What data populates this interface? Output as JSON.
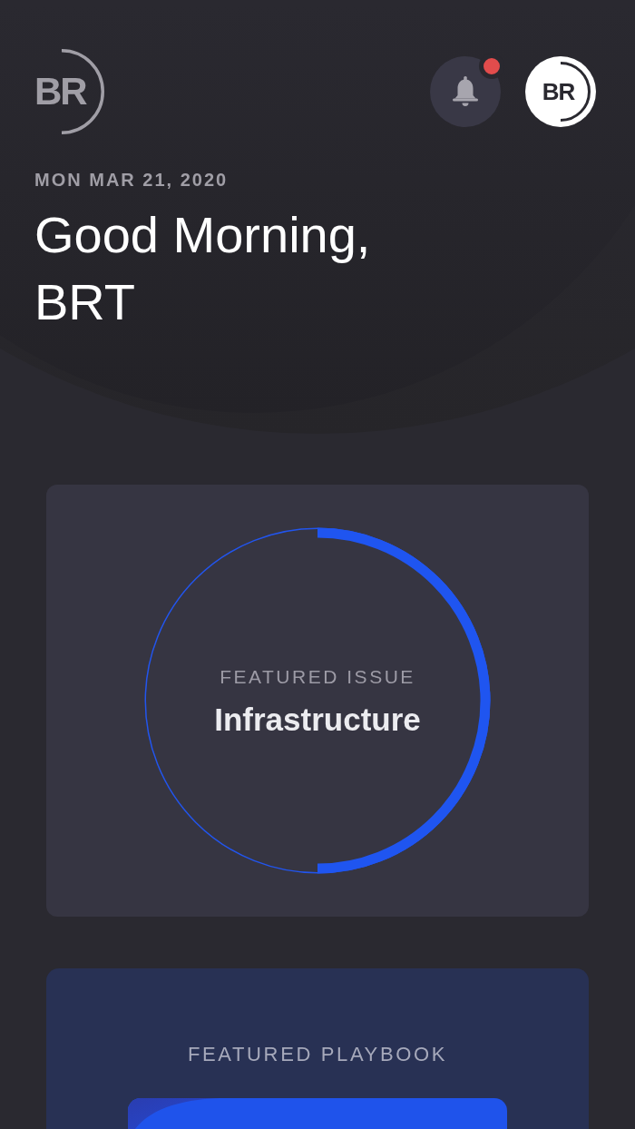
{
  "header": {
    "logo": {
      "text": "BR"
    },
    "notifications": {
      "unread": true
    },
    "avatar": {
      "initials": "BR"
    }
  },
  "date": "MON MAR 21, 2020",
  "greeting": "Good Morning,\nBRT",
  "featured_issue": {
    "label": "FEATURED ISSUE",
    "title": "Infrastructure",
    "level": 0.5
  },
  "featured_playbook": {
    "label": "FEATURED PLAYBOOK"
  }
}
